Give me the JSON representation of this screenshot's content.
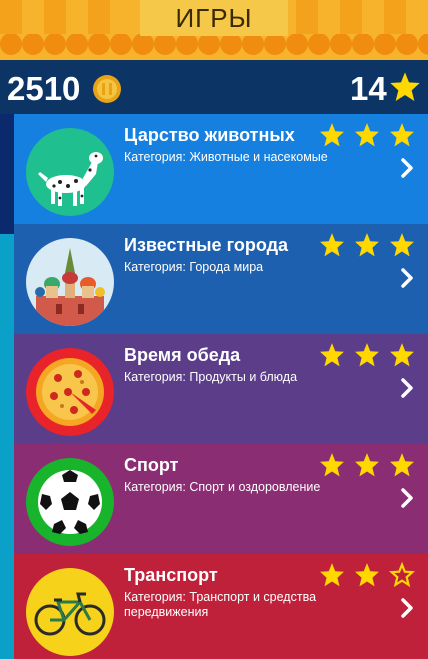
{
  "header": {
    "title": "ИГРЫ"
  },
  "stats": {
    "coins": "2510",
    "stars": "14"
  },
  "colors": {
    "header": "#f7b32b",
    "statbar": "#0c3566",
    "star": "#ffd800"
  },
  "cards": [
    {
      "title": "Царство животных",
      "category": "Категория: Животные и насекомые",
      "stars_earned": 3,
      "icon": "dalmatian-icon",
      "color": "#1580e0"
    },
    {
      "title": "Известные города",
      "category": "Категория: Города мира",
      "stars_earned": 3,
      "icon": "kremlin-icon",
      "color": "#1e60b0"
    },
    {
      "title": "Время обеда",
      "category": "Категория: Продукты и блюда",
      "stars_earned": 3,
      "icon": "pizza-icon",
      "color": "#5b3d8a"
    },
    {
      "title": "Спорт",
      "category": "Категория: Спорт и оздоровление",
      "stars_earned": 3,
      "icon": "soccer-ball-icon",
      "color": "#8a2d73"
    },
    {
      "title": "Транспорт",
      "category": "Категория: Транспорт и средства передвижения",
      "stars_earned": 2,
      "icon": "bicycle-icon",
      "color": "#c0213a"
    }
  ]
}
